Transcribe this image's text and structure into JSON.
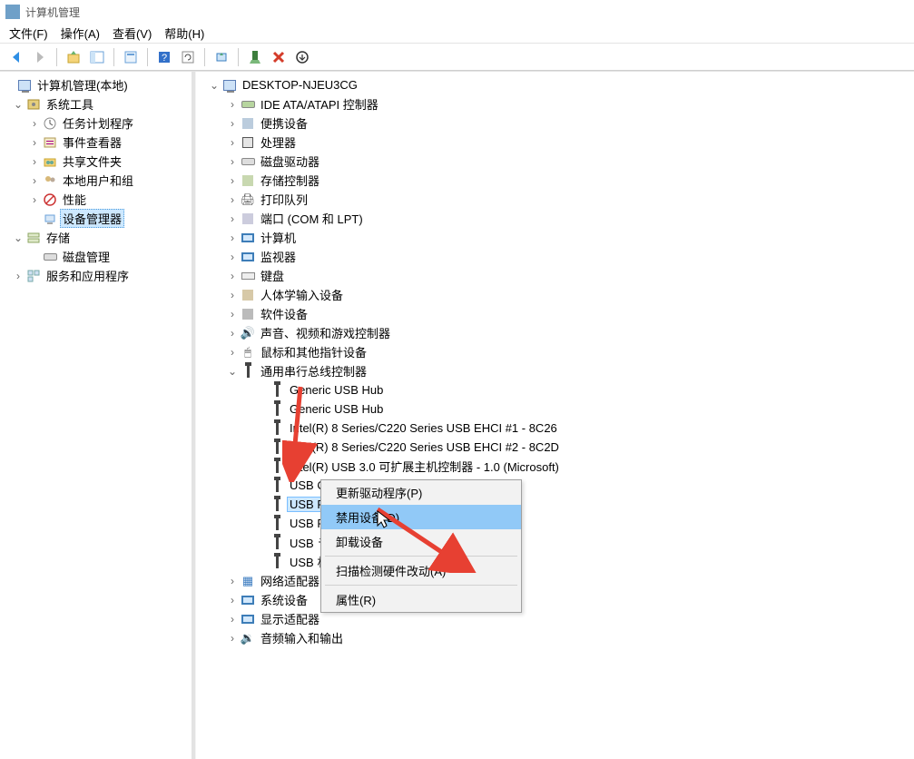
{
  "window": {
    "title": "计算机管理"
  },
  "menu": {
    "file": "文件(F)",
    "action": "操作(A)",
    "view": "查看(V)",
    "help": "帮助(H)"
  },
  "sidebar": {
    "root": "计算机管理(本地)",
    "system_tools": "系统工具",
    "st": {
      "task_scheduler": "任务计划程序",
      "event_viewer": "事件查看器",
      "shared_folders": "共享文件夹",
      "local_users": "本地用户和组",
      "performance": "性能",
      "device_manager": "设备管理器"
    },
    "storage": "存储",
    "storage_disk": "磁盘管理",
    "services_apps": "服务和应用程序"
  },
  "device_tree": {
    "computer_name": "DESKTOP-NJEU3CG",
    "cats": {
      "ide": "IDE ATA/ATAPI 控制器",
      "portable": "便携设备",
      "cpu": "处理器",
      "disk_drives": "磁盘驱动器",
      "storage_ctrl": "存储控制器",
      "print_queues": "打印队列",
      "ports": "端口 (COM 和 LPT)",
      "computers": "计算机",
      "monitors": "监视器",
      "keyboards": "键盘",
      "hid": "人体学输入设备",
      "software_dev": "软件设备",
      "sound": "声音、视频和游戏控制器",
      "mouse": "鼠标和其他指针设备",
      "usb_ctrl": "通用串行总线控制器",
      "net": "网络适配器",
      "sys_dev": "系统设备",
      "display": "显示适配器",
      "audio_in": "音频输入和输出"
    },
    "usb": {
      "hub1": "Generic USB Hub",
      "hub2": "Generic USB Hub",
      "intel1": "Intel(R) 8 Series/C220 Series USB EHCI #1 - 8C26",
      "intel2": "Intel(R) 8 Series/C220 Series USB EHCI #2 - 8C2D",
      "intel3": "Intel(R) USB 3.0 可扩展主机控制器 - 1.0 (Microsoft)",
      "composite": "USB Composite Device",
      "roothub": "USB Root Hub",
      "usbf": "USB F",
      "usbj": "USB ラ",
      "usbk": "USB 朼"
    }
  },
  "context_menu": {
    "update_driver": "更新驱动程序(P)",
    "disable": "禁用设备(D)",
    "uninstall": "卸载设备",
    "scan": "扫描检测硬件改动(A)",
    "properties": "属性(R)"
  }
}
